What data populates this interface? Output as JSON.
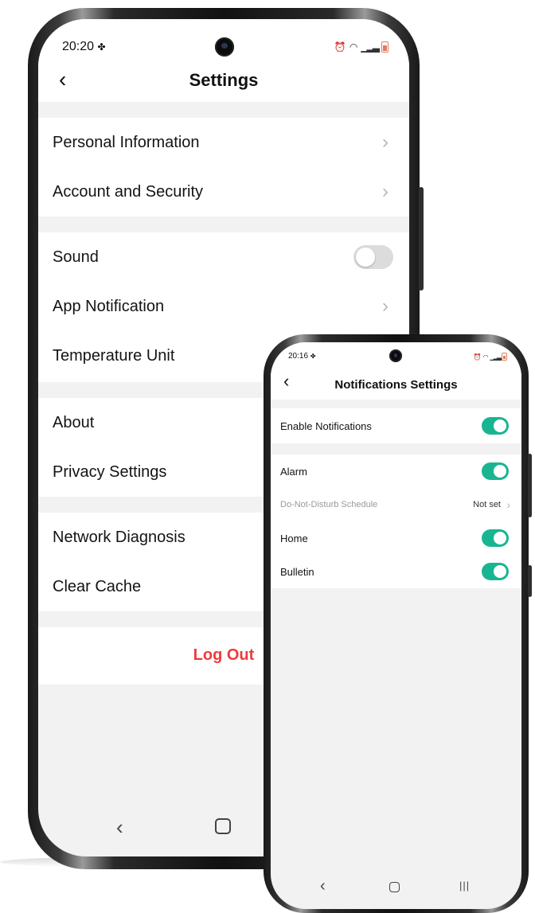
{
  "main_phone": {
    "status_time": "20:20",
    "status_extra": "✤",
    "header": {
      "title": "Settings"
    },
    "groups": [
      {
        "items": [
          {
            "label": "Personal Information",
            "control": "chevron"
          },
          {
            "label": "Account and Security",
            "control": "chevron"
          }
        ]
      },
      {
        "items": [
          {
            "label": "Sound",
            "control": "toggle-off"
          },
          {
            "label": "App Notification",
            "control": "chevron"
          },
          {
            "label": "Temperature Unit",
            "control": "none"
          }
        ]
      },
      {
        "items": [
          {
            "label": "About",
            "control": "none"
          },
          {
            "label": "Privacy Settings",
            "control": "none"
          }
        ]
      },
      {
        "items": [
          {
            "label": "Network Diagnosis",
            "control": "none"
          },
          {
            "label": "Clear Cache",
            "control": "none"
          }
        ]
      }
    ],
    "logout_label": "Log Out",
    "accent_color": "#ee3b3b"
  },
  "notif_phone": {
    "status_time": "20:16",
    "status_extra": "✤",
    "header": {
      "title": "Notifications Settings"
    },
    "enable": {
      "label": "Enable Notifications",
      "on": true
    },
    "items": [
      {
        "label": "Alarm",
        "on": true
      },
      {
        "label": "Do-Not-Disturb Schedule",
        "value": "Not set"
      },
      {
        "label": "Home",
        "on": true
      },
      {
        "label": "Bulletin",
        "on": true
      }
    ],
    "toggle_color": "#19b592"
  },
  "nav_icons": [
    "back-icon",
    "home-icon",
    "recents-icon"
  ]
}
